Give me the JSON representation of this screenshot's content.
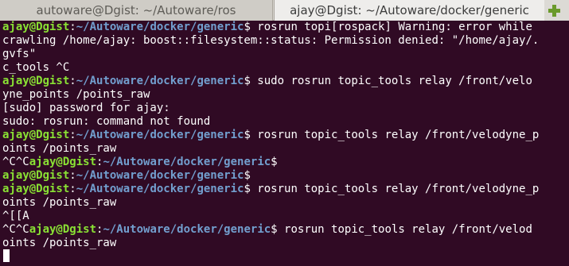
{
  "tabs": [
    {
      "label": "autoware@Dgist: ~/Autoware/ros",
      "active": false
    },
    {
      "label": "ajay@Dgist: ~/Autoware/docker/generic",
      "active": true
    }
  ],
  "new_tab_icon": "plus-icon",
  "colors": {
    "background": "#300a24",
    "prompt_user": "#8ae234",
    "prompt_path": "#729fcf",
    "text": "#ffffff"
  },
  "terminal": {
    "lines": [
      {
        "user": "ajay@Dgist",
        "colon": ":",
        "path": "~/Autoware/docker/generic",
        "text": "$ rosrun topi[rospack] Warning: error while"
      },
      {
        "text": "crawling /home/ajay: boost::filesystem::status: Permission denied: \"/home/ajay/."
      },
      {
        "text": "gvfs\""
      },
      {
        "text": "c_tools ^C"
      },
      {
        "user": "ajay@Dgist",
        "colon": ":",
        "path": "~/Autoware/docker/generic",
        "text": "$ sudo rosrun topic_tools relay /front/velo"
      },
      {
        "text": "yne_points /points_raw"
      },
      {
        "text": "[sudo] password for ajay:"
      },
      {
        "text": "sudo: rosrun: command not found"
      },
      {
        "user": "ajay@Dgist",
        "colon": ":",
        "path": "~/Autoware/docker/generic",
        "text": "$ rosrun topic_tools relay /front/velodyne_p"
      },
      {
        "text": "oints /points_raw"
      },
      {
        "prefix": "^C^C",
        "user": "ajay@Dgist",
        "colon": ":",
        "path": "~/Autoware/docker/generic",
        "text": "$"
      },
      {
        "user": "ajay@Dgist",
        "colon": ":",
        "path": "~/Autoware/docker/generic",
        "text": "$"
      },
      {
        "user": "ajay@Dgist",
        "colon": ":",
        "path": "~/Autoware/docker/generic",
        "text": "$ rosrun topic_tools relay /front/velodyne_p"
      },
      {
        "text": "oints /points_raw"
      },
      {
        "text": "^[[A"
      },
      {
        "prefix": "^C^C",
        "user": "ajay@Dgist",
        "colon": ":",
        "path": "~/Autoware/docker/generic",
        "text": "$ rosrun topic_tools relay /front/velod"
      },
      {
        "text": "oints /points_raw"
      }
    ]
  }
}
